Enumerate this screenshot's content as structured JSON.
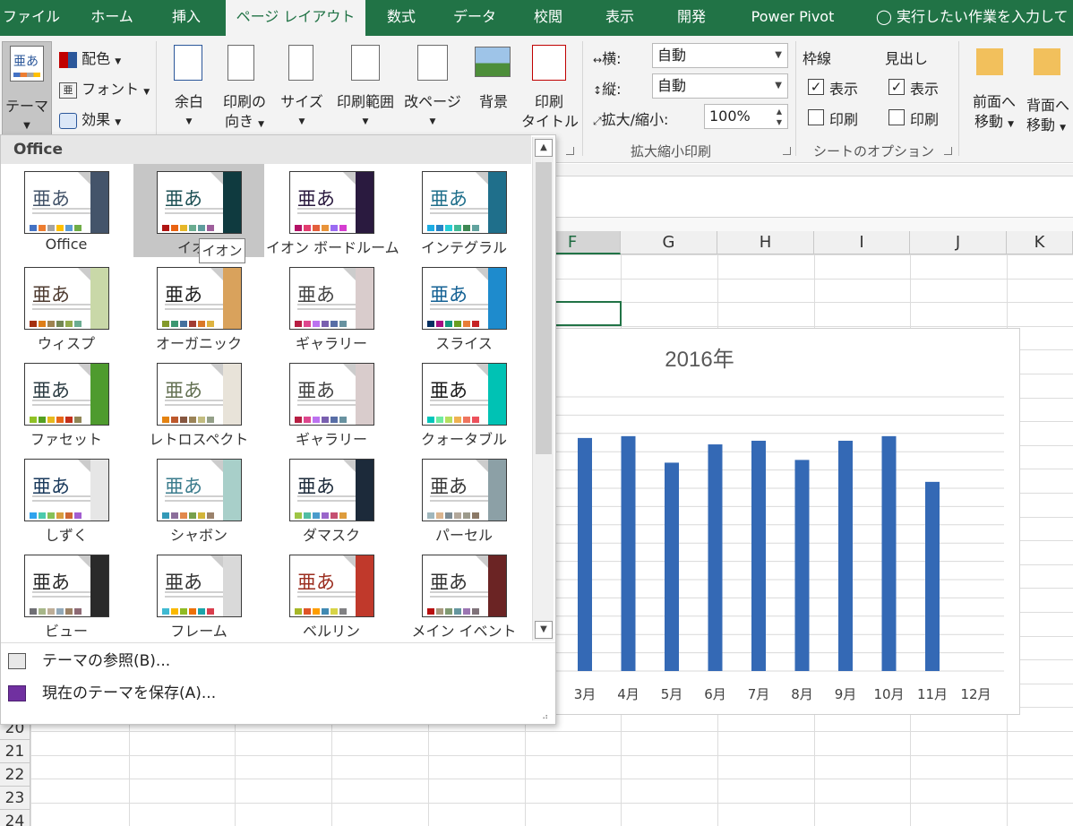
{
  "tabs": [
    "ファイル",
    "ホーム",
    "挿入",
    "ページ レイアウト",
    "数式",
    "データ",
    "校閲",
    "表示",
    "開発",
    "Power Pivot"
  ],
  "active_tab": "ページ レイアウト",
  "tell_me": "実行したい作業を入力して",
  "ribbon": {
    "theme_label": "テーマ",
    "colors": "配色",
    "fonts": "フォント",
    "effects": "効果",
    "margins": "余白",
    "orientation_1": "印刷の",
    "orientation_2": "向き",
    "size": "サイズ",
    "print_area": "印刷範囲",
    "breaks": "改ページ",
    "background": "背景",
    "print_titles_1": "印刷",
    "print_titles_2": "タイトル",
    "width_label": "横:",
    "width_value": "自動",
    "height_label": "縦:",
    "height_value": "自動",
    "scale_label": "拡大/縮小:",
    "scale_value": "100%",
    "group_scale": "拡大縮小印刷",
    "gridlines": "枠線",
    "headings": "見出し",
    "view": "表示",
    "print": "印刷",
    "group_sheet_options": "シートのオプション",
    "bring_forward_1": "前面へ",
    "bring_forward_2": "移動",
    "send_backward_1": "背面へ",
    "send_backward_2": "移動"
  },
  "gallery": {
    "header": "Office",
    "glyph": "亜あ",
    "tooltip": "イオン",
    "themes": [
      {
        "name": "Office",
        "side": "#44546a",
        "dots": [
          "#4472c4",
          "#ed7d31",
          "#a5a5a5",
          "#ffc000",
          "#5b9bd5",
          "#70ad47"
        ],
        "glyph_color": "#44546a"
      },
      {
        "name": "イオン",
        "side": "#0f3a3f",
        "dots": [
          "#b01513",
          "#ea6312",
          "#e6b729",
          "#6aac90",
          "#5f9c9d",
          "#9e5e9b"
        ],
        "glyph_color": "#1e5155"
      },
      {
        "name": "イオン ボードルーム",
        "side": "#2a1a3f",
        "dots": [
          "#b31166",
          "#e33d6f",
          "#e45f3c",
          "#e9943a",
          "#9b6bf2",
          "#d53dd0"
        ],
        "glyph_color": "#2a1a3f"
      },
      {
        "name": "インテグラル",
        "side": "#1f6f8b",
        "dots": [
          "#1cade4",
          "#2683c6",
          "#27ced7",
          "#42ba97",
          "#3e8853",
          "#62a39f"
        ],
        "glyph_color": "#1f6f8b"
      },
      {
        "name": "ウィスプ",
        "side": "#c9d8a8",
        "dots": [
          "#a53010",
          "#de7e18",
          "#9f8351",
          "#728653",
          "#92aa4c",
          "#6aac91"
        ],
        "glyph_color": "#4e3b30"
      },
      {
        "name": "オーガニック",
        "side": "#d9a25c",
        "dots": [
          "#83992a",
          "#3c9770",
          "#44709d",
          "#a23c33",
          "#d97828",
          "#deb340"
        ],
        "glyph_color": "#212121"
      },
      {
        "name": "ギャラリー",
        "side": "#d9cccc",
        "dots": [
          "#b71e42",
          "#de478e",
          "#bc72f0",
          "#795faf",
          "#586ea6",
          "#6892a0"
        ],
        "glyph_color": "#444444"
      },
      {
        "name": "スライス",
        "side": "#1e8bcd",
        "dots": [
          "#052f61",
          "#a50e82",
          "#14967c",
          "#6a9e1f",
          "#e87d37",
          "#c62324"
        ],
        "glyph_color": "#146194"
      },
      {
        "name": "ファセット",
        "side": "#4e9b2e",
        "dots": [
          "#90c226",
          "#54a021",
          "#e6b91e",
          "#e76618",
          "#c42f1a",
          "#918655"
        ],
        "glyph_color": "#2c3c43"
      },
      {
        "name": "レトロスペクト",
        "side": "#e8e3d9",
        "dots": [
          "#e48312",
          "#bd582c",
          "#865640",
          "#9b8357",
          "#c2bc80",
          "#94a088"
        ],
        "glyph_color": "#637052"
      },
      {
        "name": "ギャラリー",
        "side": "#d9cccc",
        "dots": [
          "#b71e42",
          "#de478e",
          "#bc72f0",
          "#795faf",
          "#586ea6",
          "#6892a0"
        ],
        "glyph_color": "#444444"
      },
      {
        "name": "クォータブル",
        "side": "#00c2b4",
        "dots": [
          "#00c6bb",
          "#6feba0",
          "#b6df5e",
          "#efb251",
          "#ef755f",
          "#ed515c"
        ],
        "glyph_color": "#1a1a1a"
      },
      {
        "name": "しずく",
        "side": "#e6e6e6",
        "dots": [
          "#2fa3ee",
          "#4bcaad",
          "#86c157",
          "#d99c3f",
          "#ce6633",
          "#a35dd1"
        ],
        "glyph_color": "#1a3a5c"
      },
      {
        "name": "シャボン",
        "side": "#a8cfc9",
        "dots": [
          "#3399b7",
          "#8c6e9b",
          "#e2884c",
          "#78a04d",
          "#d3b539",
          "#9b826b"
        ],
        "glyph_color": "#3a7b8c"
      },
      {
        "name": "ダマスク",
        "side": "#1c2a3a",
        "dots": [
          "#9ec544",
          "#50bea3",
          "#4a9ccc",
          "#9a66ca",
          "#c54f71",
          "#de9c3c"
        ],
        "glyph_color": "#1c2a3a"
      },
      {
        "name": "パーセル",
        "side": "#8ca0a6",
        "dots": [
          "#a0b7bd",
          "#dbb58f",
          "#7e8c94",
          "#b3a89b",
          "#9c9a8b",
          "#8b7966"
        ],
        "glyph_color": "#363636"
      },
      {
        "name": "ビュー",
        "side": "#2a2a2a",
        "dots": [
          "#6f6f74",
          "#a7b789",
          "#beae98",
          "#92a9b9",
          "#9c8265",
          "#8d6974"
        ],
        "glyph_color": "#2a2a2a"
      },
      {
        "name": "フレーム",
        "side": "#d9d9d9",
        "dots": [
          "#40bad2",
          "#fab900",
          "#90bb23",
          "#ee7008",
          "#1aa4aa",
          "#d93d4c"
        ],
        "glyph_color": "#333333"
      },
      {
        "name": "ベルリン",
        "side": "#c0392b",
        "dots": [
          "#a6b727",
          "#df5327",
          "#fe9e00",
          "#418ab3",
          "#d7d447",
          "#818183"
        ],
        "glyph_color": "#9b2d1f"
      },
      {
        "name": "メイン イベント",
        "side": "#6b2424",
        "dots": [
          "#b80e0f",
          "#a6987d",
          "#7f9a71",
          "#64969f",
          "#9b75b2",
          "#80737a"
        ],
        "glyph_color": "#333333"
      }
    ]
  },
  "menu": {
    "browse": "テーマの参照(B)...",
    "save": "現在のテーマを保存(A)..."
  },
  "sheet": {
    "columns": [
      "F",
      "G",
      "H",
      "I",
      "J",
      "K"
    ],
    "selected_column": "F",
    "rows": [
      "20",
      "21",
      "22",
      "23",
      "24"
    ]
  },
  "chart_data": {
    "type": "bar",
    "title": "2016年",
    "categories": [
      "3月",
      "4月",
      "5月",
      "6月",
      "7月",
      "8月",
      "9月",
      "10月",
      "11月",
      "12月"
    ],
    "values": [
      255,
      257,
      228,
      248,
      252,
      231,
      252,
      257,
      207,
      0
    ],
    "ylim": [
      0,
      300
    ],
    "bar_color": "#3469b5",
    "grid": true
  }
}
